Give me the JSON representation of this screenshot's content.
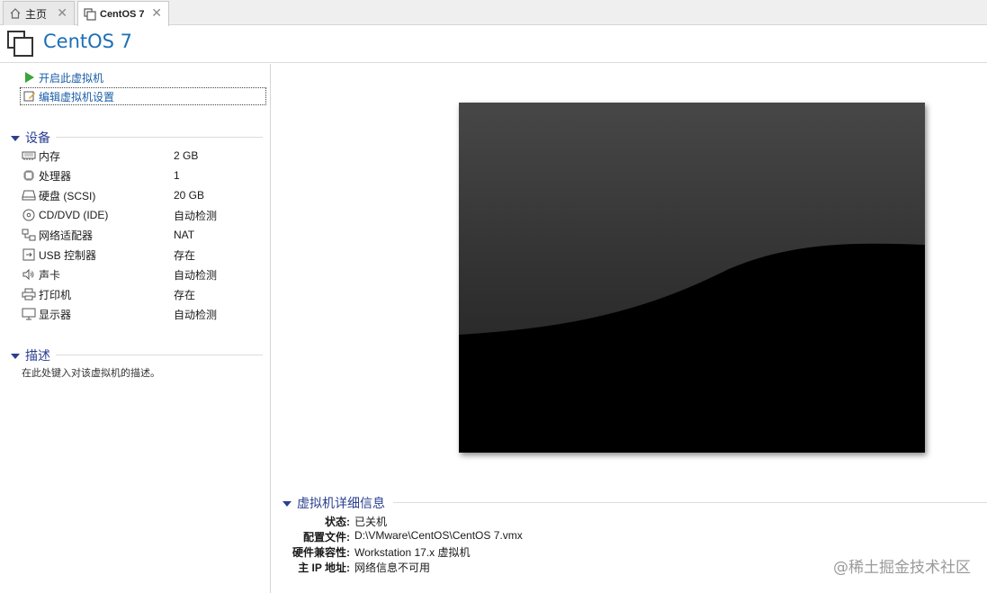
{
  "tabs": [
    {
      "label": "主页",
      "icon": "home-icon",
      "active": false
    },
    {
      "label": "CentOS 7",
      "icon": "vm-icon",
      "active": true
    }
  ],
  "header": {
    "title": "CentOS 7",
    "icon": "vm-icon"
  },
  "actions": {
    "power_on": "开启此虚拟机",
    "edit_settings": "编辑虚拟机设置"
  },
  "devices": {
    "title": "设备",
    "items": [
      {
        "name": "内存",
        "value": "2 GB",
        "icon": "memory-icon"
      },
      {
        "name": "处理器",
        "value": "1",
        "icon": "cpu-icon"
      },
      {
        "name": "硬盘 (SCSI)",
        "value": "20 GB",
        "icon": "harddisk-icon"
      },
      {
        "name": "CD/DVD (IDE)",
        "value": "自动检测",
        "icon": "cd-icon"
      },
      {
        "name": "网络适配器",
        "value": "NAT",
        "icon": "network-icon"
      },
      {
        "name": "USB 控制器",
        "value": "存在",
        "icon": "usb-icon"
      },
      {
        "name": "声卡",
        "value": "自动检测",
        "icon": "sound-icon"
      },
      {
        "name": "打印机",
        "value": "存在",
        "icon": "printer-icon"
      },
      {
        "name": "显示器",
        "value": "自动检测",
        "icon": "display-icon"
      }
    ]
  },
  "description": {
    "title": "描述",
    "placeholder": "在此处键入对该虚拟机的描述。"
  },
  "details": {
    "title": "虚拟机详细信息",
    "rows": [
      {
        "key": "状态:",
        "value": "已关机"
      },
      {
        "key": "配置文件:",
        "value": "D:\\VMware\\CentOS\\CentOS 7.vmx"
      },
      {
        "key": "硬件兼容性:",
        "value": "Workstation 17.x 虚拟机"
      },
      {
        "key": "主 IP 地址:",
        "value": "网络信息不可用"
      }
    ]
  },
  "watermark": "@稀土掘金技术社区",
  "colors": {
    "accent": "#1d6fb8",
    "section": "#2a3f8f",
    "play": "#3aa53a"
  }
}
